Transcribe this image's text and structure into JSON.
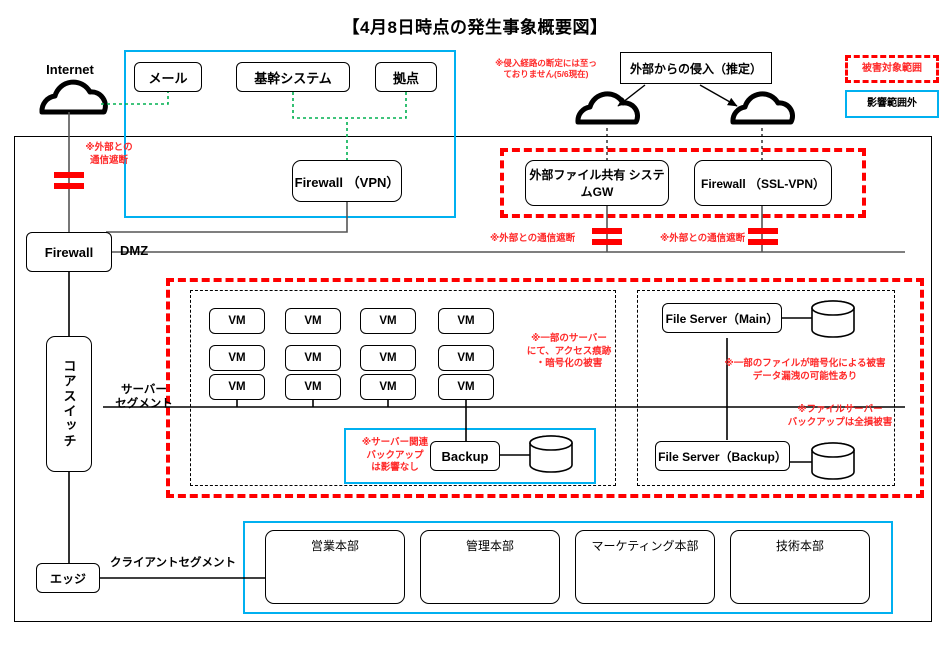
{
  "title": "【4月8日時点の発生事象概要図】",
  "legend": {
    "damage_scope": "被害対象範囲",
    "out_of_scope": "影響範囲外"
  },
  "external": {
    "internet_label": "Internet",
    "intrusion_box": "外部からの侵入（推定）",
    "intrusion_note": "※侵入経路の断定には至っ\nておりません(5/6現在)"
  },
  "top_systems": [
    {
      "label": "メール"
    },
    {
      "label": "基幹システム"
    },
    {
      "label": "拠点"
    }
  ],
  "dmz": {
    "firewall_vpn": "Firewall\n（VPN）",
    "ext_file_gw": "外部ファイル共有\nシステムGW",
    "firewall_sslvpn": "Firewall\n（SSL-VPN）",
    "dmz_label": "DMZ",
    "cut_note": "※外部との通信遮断",
    "cut_note_internet": "※外部との\n通信遮断"
  },
  "left_column": {
    "firewall": "Firewall",
    "core_switch": "コアスイッチ",
    "edge": "エッジ",
    "server_segment": "サーバー\nセグメント",
    "client_segment": "クライアントセグメント"
  },
  "server_zone": {
    "vm_label": "VM",
    "vm_count": 12,
    "vm_note": "※一部のサーバー\nにて、アクセス痕跡\n・暗号化の被害",
    "backup_label": "Backup",
    "backup_note": "※サーバー関連\nバックアップ\nは影響なし",
    "file_server_main": "File Server（Main）",
    "file_server_backup": "File Server（Backup）",
    "fs_note": "※一部のファイルが暗号化による被害\nデータ漏洩の可能性あり",
    "fs_backup_note": "※ファイルサーバー\nバックアップは全損被害"
  },
  "departments": [
    {
      "label": "営業本部"
    },
    {
      "label": "管理本部"
    },
    {
      "label": "マーケティング本部"
    },
    {
      "label": "技術本部"
    }
  ],
  "colors": {
    "damage_red": "#ff0000",
    "note_red": "#ff2a2a",
    "safe_cyan": "#00b0f0",
    "link_green": "#00b050",
    "line_black": "#000000"
  }
}
